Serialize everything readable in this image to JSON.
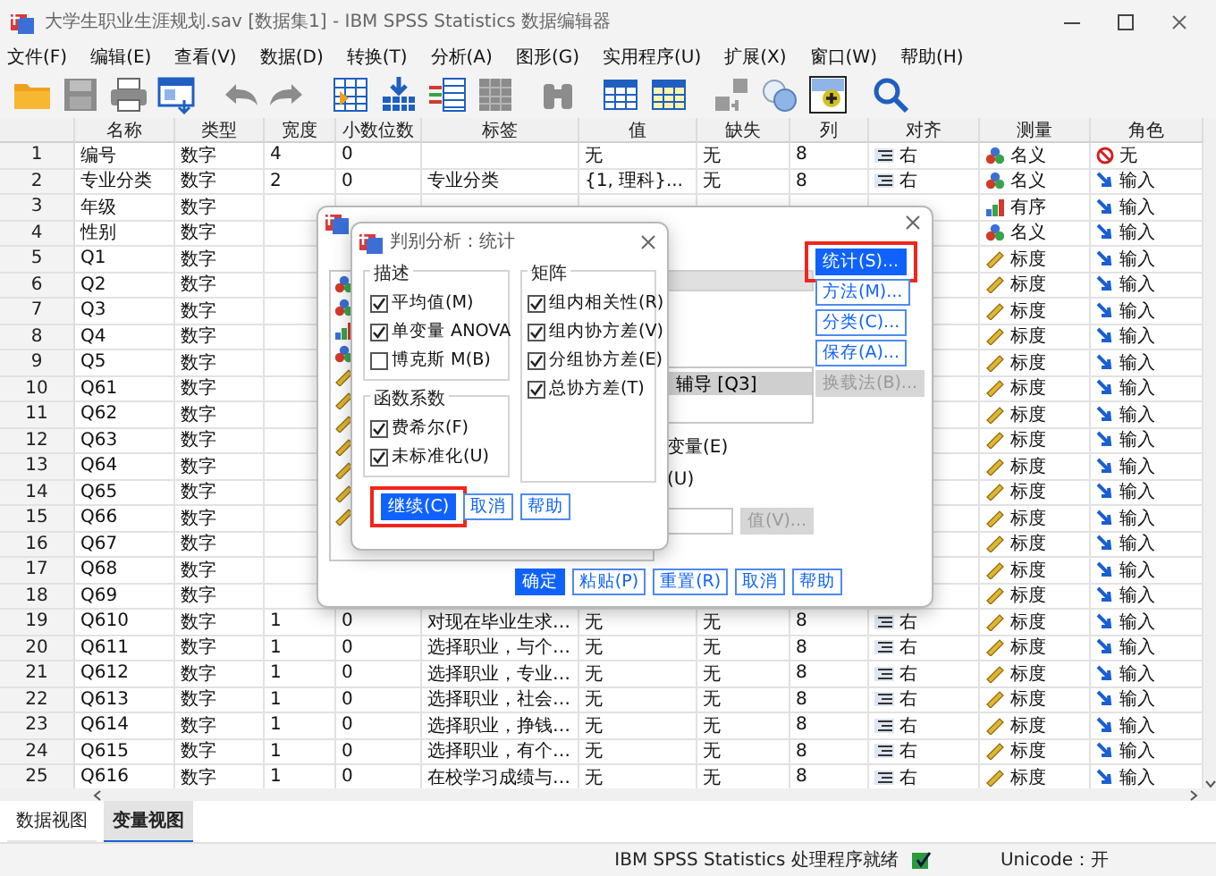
{
  "window": {
    "title": "大学生职业生涯规划.sav [数据集1] - IBM SPSS Statistics 数据编辑器"
  },
  "menu": [
    "文件(F)",
    "编辑(E)",
    "查看(V)",
    "数据(D)",
    "转换(T)",
    "分析(A)",
    "图形(G)",
    "实用程序(U)",
    "扩展(X)",
    "窗口(W)",
    "帮助(H)"
  ],
  "toolbar": [
    [
      {
        "kind": "folder"
      },
      {
        "kind": "disk"
      },
      {
        "kind": "printer"
      },
      {
        "kind": "window"
      }
    ],
    [
      {
        "kind": "undo"
      },
      {
        "kind": "redo"
      }
    ],
    [
      {
        "kind": "goto-case"
      },
      {
        "kind": "goto-variable"
      },
      {
        "kind": "variables"
      },
      {
        "kind": "grid"
      }
    ],
    [
      {
        "kind": "binoculars"
      }
    ],
    [
      {
        "kind": "insert-cases"
      },
      {
        "kind": "insert-variable"
      }
    ],
    [
      {
        "kind": "split"
      },
      {
        "kind": "circles"
      },
      {
        "kind": "plus-square"
      }
    ],
    [
      {
        "kind": "search"
      }
    ]
  ],
  "table": {
    "columns": [
      "名称",
      "类型",
      "宽度",
      "小数位数",
      "标签",
      "值",
      "缺失",
      "列",
      "对齐",
      "测量",
      "角色"
    ],
    "rows": [
      {
        "number": "1",
        "cells": [
          "编号",
          "数字",
          "4",
          "0",
          null,
          "无",
          "无",
          "8",
          "右"
        ],
        "measure": {
          "kind": "nominal",
          "text": "名义"
        },
        "role": {
          "kind": "none",
          "text": "无"
        }
      },
      {
        "number": "2",
        "cells": [
          "专业分类",
          "数字",
          "2",
          "0",
          "专业分类",
          "{1, 理科}...",
          "无",
          "8",
          "右"
        ],
        "measure": {
          "kind": "nominal",
          "text": "名义"
        },
        "role": {
          "kind": "input",
          "text": "输入"
        }
      },
      {
        "number": "3",
        "cells": [
          "年级",
          "数字"
        ],
        "measure": {
          "kind": "ordinal",
          "text": "有序"
        },
        "role": {
          "kind": "input",
          "text": "输入"
        }
      },
      {
        "number": "4",
        "cells": [
          "性别",
          "数字"
        ],
        "measure": {
          "kind": "nominal",
          "text": "名义"
        },
        "role": {
          "kind": "input",
          "text": "输入"
        }
      },
      {
        "number": "5",
        "cells": [
          "Q1",
          "数字"
        ],
        "measure": {
          "kind": "scale",
          "text": "标度"
        },
        "role": {
          "kind": "input",
          "text": "输入"
        }
      },
      {
        "number": "6",
        "cells": [
          "Q2",
          "数字"
        ],
        "measure": {
          "kind": "scale",
          "text": "标度"
        },
        "role": {
          "kind": "input",
          "text": "输入"
        }
      },
      {
        "number": "7",
        "cells": [
          "Q3",
          "数字"
        ],
        "measure": {
          "kind": "scale",
          "text": "标度"
        },
        "role": {
          "kind": "input",
          "text": "输入"
        }
      },
      {
        "number": "8",
        "cells": [
          "Q4",
          "数字"
        ],
        "measure": {
          "kind": "scale",
          "text": "标度"
        },
        "role": {
          "kind": "input",
          "text": "输入"
        }
      },
      {
        "number": "9",
        "cells": [
          "Q5",
          "数字"
        ],
        "measure": {
          "kind": "scale",
          "text": "标度"
        },
        "role": {
          "kind": "input",
          "text": "输入"
        }
      },
      {
        "number": "10",
        "cells": [
          "Q61",
          "数字"
        ],
        "measure": {
          "kind": "scale",
          "text": "标度"
        },
        "role": {
          "kind": "input",
          "text": "输入"
        }
      },
      {
        "number": "11",
        "cells": [
          "Q62",
          "数字"
        ],
        "measure": {
          "kind": "scale",
          "text": "标度"
        },
        "role": {
          "kind": "input",
          "text": "输入"
        }
      },
      {
        "number": "12",
        "cells": [
          "Q63",
          "数字"
        ],
        "measure": {
          "kind": "scale",
          "text": "标度"
        },
        "role": {
          "kind": "input",
          "text": "输入"
        }
      },
      {
        "number": "13",
        "cells": [
          "Q64",
          "数字"
        ],
        "measure": {
          "kind": "scale",
          "text": "标度"
        },
        "role": {
          "kind": "input",
          "text": "输入"
        }
      },
      {
        "number": "14",
        "cells": [
          "Q65",
          "数字"
        ],
        "measure": {
          "kind": "scale",
          "text": "标度"
        },
        "role": {
          "kind": "input",
          "text": "输入"
        }
      },
      {
        "number": "15",
        "cells": [
          "Q66",
          "数字"
        ],
        "measure": {
          "kind": "scale",
          "text": "标度"
        },
        "role": {
          "kind": "input",
          "text": "输入"
        }
      },
      {
        "number": "16",
        "cells": [
          "Q67",
          "数字"
        ],
        "measure": {
          "kind": "scale",
          "text": "标度"
        },
        "role": {
          "kind": "input",
          "text": "输入"
        }
      },
      {
        "number": "17",
        "cells": [
          "Q68",
          "数字"
        ],
        "measure": {
          "kind": "scale",
          "text": "标度"
        },
        "role": {
          "kind": "input",
          "text": "输入"
        }
      },
      {
        "number": "18",
        "cells": [
          "Q69",
          "数字"
        ],
        "measure": {
          "kind": "scale",
          "text": "标度"
        },
        "role": {
          "kind": "input",
          "text": "输入"
        }
      },
      {
        "number": "19",
        "cells": [
          "Q610",
          "数字",
          "1",
          "0",
          "对现在毕业生求…",
          "无",
          "无",
          "8",
          "右"
        ],
        "measure": {
          "kind": "scale",
          "text": "标度"
        },
        "role": {
          "kind": "input",
          "text": "输入"
        }
      },
      {
        "number": "20",
        "cells": [
          "Q611",
          "数字",
          "1",
          "0",
          "选择职业，与个…",
          "无",
          "无",
          "8",
          "右"
        ],
        "measure": {
          "kind": "scale",
          "text": "标度"
        },
        "role": {
          "kind": "input",
          "text": "输入"
        }
      },
      {
        "number": "21",
        "cells": [
          "Q612",
          "数字",
          "1",
          "0",
          "选择职业，专业…",
          "无",
          "无",
          "8",
          "右"
        ],
        "measure": {
          "kind": "scale",
          "text": "标度"
        },
        "role": {
          "kind": "input",
          "text": "输入"
        }
      },
      {
        "number": "22",
        "cells": [
          "Q613",
          "数字",
          "1",
          "0",
          "选择职业，社会…",
          "无",
          "无",
          "8",
          "右"
        ],
        "measure": {
          "kind": "scale",
          "text": "标度"
        },
        "role": {
          "kind": "input",
          "text": "输入"
        }
      },
      {
        "number": "23",
        "cells": [
          "Q614",
          "数字",
          "1",
          "0",
          "选择职业，挣钱…",
          "无",
          "无",
          "8",
          "右"
        ],
        "measure": {
          "kind": "scale",
          "text": "标度"
        },
        "role": {
          "kind": "input",
          "text": "输入"
        }
      },
      {
        "number": "24",
        "cells": [
          "Q615",
          "数字",
          "1",
          "0",
          "选择职业，有个…",
          "无",
          "无",
          "8",
          "右"
        ],
        "measure": {
          "kind": "scale",
          "text": "标度"
        },
        "role": {
          "kind": "input",
          "text": "输入"
        }
      },
      {
        "number": "25",
        "cells": [
          "Q616",
          "数字",
          "1",
          "0",
          "在校学习成绩与…",
          "无",
          "无",
          "8",
          "右"
        ],
        "measure": {
          "kind": "scale",
          "text": "标度"
        },
        "role": {
          "kind": "input",
          "text": "输入"
        }
      }
    ]
  },
  "dialog": {
    "variable_list": [
      {
        "kind": "nominal"
      },
      {
        "kind": "nominal"
      },
      {
        "kind": "ordinal"
      },
      {
        "kind": "nominal"
      },
      {
        "kind": "scale"
      },
      {
        "kind": "scale"
      },
      {
        "kind": "scale"
      },
      {
        "kind": "scale"
      },
      {
        "kind": "scale"
      },
      {
        "kind": "scale"
      },
      {
        "kind": "scale"
      }
    ],
    "target_list": [
      {
        "text": "辅导 [Q3]",
        "selected": true
      }
    ],
    "options": [
      "变量(E)",
      "(U)"
    ],
    "value_button": {
      "label": "值(V)...",
      "kind": "disabled"
    },
    "side_buttons": [
      {
        "label": "统计(S)...",
        "kind": "primary",
        "highlighted": true
      },
      {
        "label": "方法(M)...",
        "kind": "default",
        "highlighted": false
      },
      {
        "label": "分类(C)...",
        "kind": "default",
        "highlighted": false
      },
      {
        "label": "保存(A)...",
        "kind": "default",
        "highlighted": false
      },
      {
        "label": "换载法(B)...",
        "kind": "disabled",
        "highlighted": false
      }
    ],
    "buttons": [
      {
        "label": "确定",
        "kind": "primary",
        "highlighted": false
      },
      {
        "label": "粘贴(P)",
        "kind": "default",
        "highlighted": false
      },
      {
        "label": "重置(R)",
        "kind": "default",
        "highlighted": false
      },
      {
        "label": "取消",
        "kind": "default",
        "highlighted": false
      },
      {
        "label": "帮助",
        "kind": "default",
        "highlighted": false
      }
    ]
  },
  "sub_dialog": {
    "title": "判别分析：统计",
    "groups": [
      {
        "title": "描述",
        "items": [
          {
            "label": "平均值(M)",
            "checked": true
          },
          {
            "label": "单变量 ANOVA",
            "checked": true
          },
          {
            "label": "博克斯 M(B)",
            "checked": false
          }
        ]
      },
      {
        "title": "函数系数",
        "items": [
          {
            "label": "费希尔(F)",
            "checked": true
          },
          {
            "label": "未标准化(U)",
            "checked": true
          }
        ]
      },
      {
        "title": "矩阵",
        "items": [
          {
            "label": "组内相关性(R)",
            "checked": true
          },
          {
            "label": "组内协方差(V)",
            "checked": true
          },
          {
            "label": "分组协方差(E)",
            "checked": true
          },
          {
            "label": "总协方差(T)",
            "checked": true
          }
        ]
      }
    ],
    "buttons": [
      {
        "label": "继续(C)",
        "kind": "primary",
        "highlighted": true
      },
      {
        "label": "取消",
        "kind": "default",
        "highlighted": false
      },
      {
        "label": "帮助",
        "kind": "default",
        "highlighted": false
      }
    ]
  },
  "tabs": [
    {
      "label": "数据视图",
      "selected": false
    },
    {
      "label": "变量视图",
      "selected": true
    }
  ],
  "status_bar": {
    "message": "IBM SPSS Statistics 处理程序就绪",
    "encoding": "Unicode：开"
  }
}
